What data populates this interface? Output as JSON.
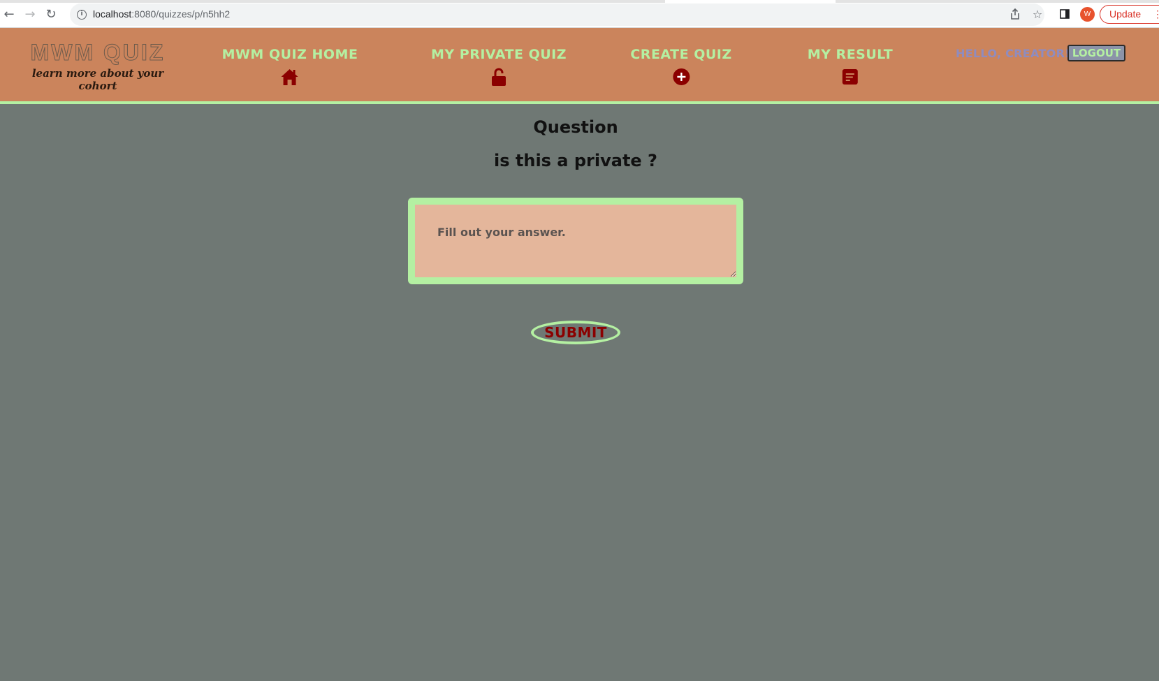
{
  "browser": {
    "url_host": "localhost",
    "url_path": ":8080/quizzes/p/n5hh2",
    "profile_initial": "W",
    "update_label": "Update",
    "icons": [
      "back-icon",
      "forward-icon",
      "reload-icon",
      "info-icon",
      "share-icon",
      "star-icon",
      "side-panel-icon",
      "kebab-menu-icon"
    ]
  },
  "header": {
    "logo_title": "MWM  QUIZ",
    "logo_tagline": "learn more about your cohort",
    "nav": [
      {
        "label": "MWM QUIZ HOME",
        "icon": "home-icon"
      },
      {
        "label": "MY PRIVATE QUIZ",
        "icon": "unlock-icon"
      },
      {
        "label": "CREATE QUIZ",
        "icon": "plus-circle-icon"
      },
      {
        "label": "MY RESULT",
        "icon": "document-icon"
      }
    ],
    "greeting": "HELLO, CREATOR!",
    "logout_label": "LOGOUT"
  },
  "main": {
    "heading": "Question",
    "question": "is this a private ?",
    "answer_placeholder": "Fill out your answer.",
    "answer_value": "",
    "submit_label": "SUBMIT"
  },
  "colors": {
    "header_bg": "#cb845c",
    "accent_green": "#b4f0a2",
    "page_bg": "#6f7874",
    "icon_dark_red": "#8b0000",
    "answer_bg": "#e4b69b",
    "greeting": "#8f8cbf"
  }
}
